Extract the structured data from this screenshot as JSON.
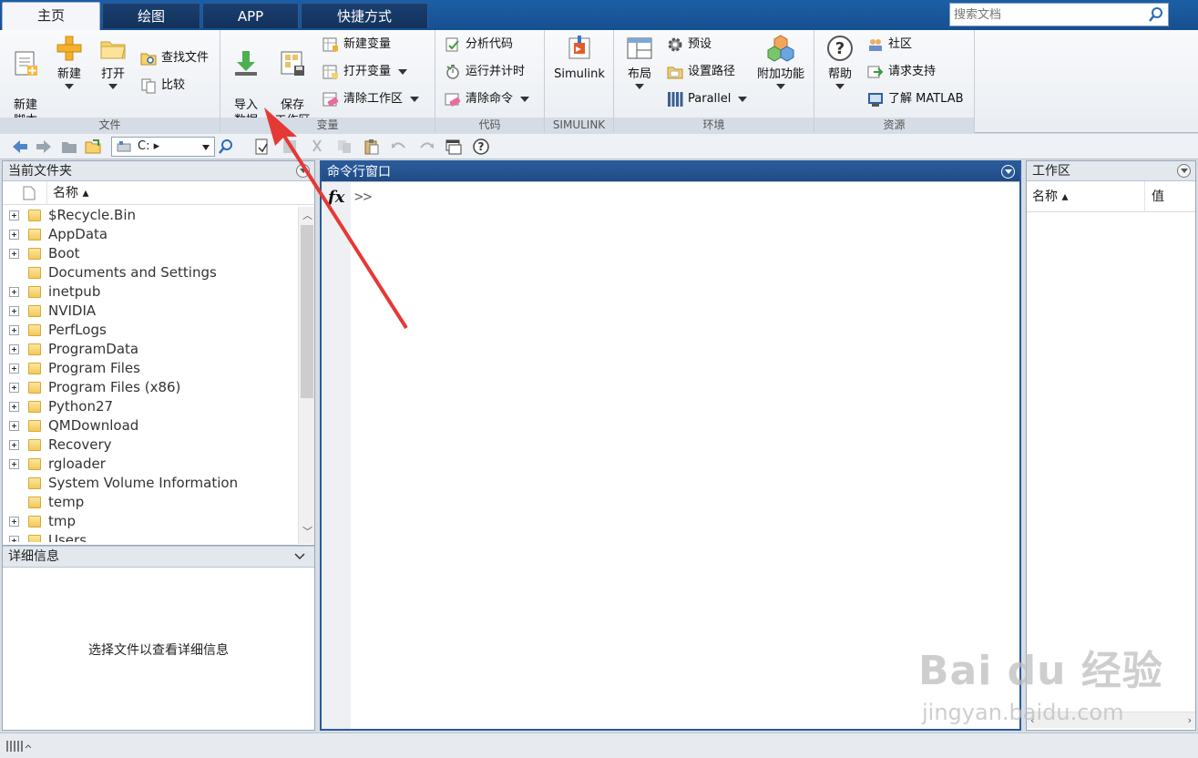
{
  "tabs": [
    {
      "label": "主页"
    },
    {
      "label": "绘图"
    },
    {
      "label": "APP"
    },
    {
      "label": "快捷方式"
    }
  ],
  "search": {
    "placeholder": "搜索文档"
  },
  "ribbon": {
    "file": {
      "label": "文件",
      "new_script": "新建\n脚本",
      "new": "新建",
      "open": "打开",
      "find_files": "查找文件",
      "compare": "比较"
    },
    "variable": {
      "label": "变量",
      "import_data": "导入\n数据",
      "save_workspace": "保存\n工作区",
      "new_variable": "新建变量",
      "open_variable": "打开变量",
      "clear_workspace": "清除工作区"
    },
    "code": {
      "label": "代码",
      "analyze_code": "分析代码",
      "run_and_time": "运行并计时",
      "clear_commands": "清除命令"
    },
    "simulink": {
      "label": "SIMULINK",
      "simulink": "Simulink"
    },
    "environment": {
      "label": "环境",
      "layout": "布局",
      "preferences": "预设",
      "set_path": "设置路径",
      "parallel": "Parallel",
      "add_ons": "附加功能"
    },
    "resources": {
      "label": "资源",
      "help": "帮助",
      "community": "社区",
      "request_support": "请求支持",
      "learn_matlab": "了解 MATLAB"
    }
  },
  "toolbar": {
    "path": "C: ▸"
  },
  "current_folder": {
    "title": "当前文件夹",
    "column_name": "名称 ▴",
    "items": [
      {
        "name": "$Recycle.Bin",
        "expandable": true
      },
      {
        "name": "AppData",
        "expandable": true
      },
      {
        "name": "Boot",
        "expandable": true
      },
      {
        "name": "Documents and Settings",
        "expandable": false
      },
      {
        "name": "inetpub",
        "expandable": true
      },
      {
        "name": "NVIDIA",
        "expandable": true
      },
      {
        "name": "PerfLogs",
        "expandable": true
      },
      {
        "name": "ProgramData",
        "expandable": true
      },
      {
        "name": "Program Files",
        "expandable": true
      },
      {
        "name": "Program Files (x86)",
        "expandable": true
      },
      {
        "name": "Python27",
        "expandable": true
      },
      {
        "name": "QMDownload",
        "expandable": true
      },
      {
        "name": "Recovery",
        "expandable": true
      },
      {
        "name": "rgloader",
        "expandable": true
      },
      {
        "name": "System Volume Information",
        "expandable": false
      },
      {
        "name": "temp",
        "expandable": false
      },
      {
        "name": "tmp",
        "expandable": true
      },
      {
        "name": "Users",
        "expandable": true
      }
    ]
  },
  "details": {
    "title": "详细信息",
    "message": "选择文件以查看详细信息"
  },
  "command_window": {
    "title": "命令行窗口",
    "fx": "fx",
    "prompt": ">>"
  },
  "workspace": {
    "title": "工作区",
    "col_name": "名称 ▴",
    "col_value": "值"
  },
  "watermark": {
    "brand": "Bai  du 经验",
    "url": "jingyan.baidu.com"
  },
  "colors": {
    "tab_bar": "#1c5ea6",
    "command_header": "#2a5b9a",
    "annotation_arrow": "#e53935"
  }
}
